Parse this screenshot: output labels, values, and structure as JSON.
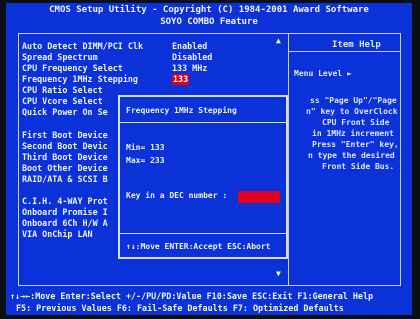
{
  "header": {
    "title": "CMOS Setup Utility - Copyright (C) 1984-2001 Award Software",
    "subtitle": "SOYO COMBO Feature"
  },
  "menu_items": [
    {
      "label": "Auto Detect DIMM/PCI Clk",
      "value": "Enabled"
    },
    {
      "label": "Spread Spectrum",
      "value": "Disabled"
    },
    {
      "label": "CPU Frequency Select",
      "value": "133 MHz"
    },
    {
      "label": "Frequency 1MHz Stepping",
      "value": "133"
    },
    {
      "label": "CPU Ratio Select",
      "value": ""
    },
    {
      "label": "CPU Vcore Select",
      "value": ""
    },
    {
      "label": "Quick Power On Se",
      "value": ""
    },
    {
      "label": "First Boot Device",
      "value": ""
    },
    {
      "label": "Second Boot Devic",
      "value": ""
    },
    {
      "label": "Third Boot Device",
      "value": ""
    },
    {
      "label": "Boot Other Device",
      "value": ""
    },
    {
      "label": "RAID/ATA & SCSI B",
      "value": ""
    },
    {
      "label": "C.I.H. 4-WAY Prot",
      "value": ""
    },
    {
      "label": "Onboard Promise I",
      "value": ""
    },
    {
      "label": "Onboard 6Ch H/W A",
      "value": ""
    },
    {
      "label": "VIA OnChip LAN",
      "value": ""
    }
  ],
  "help_panel": {
    "title": "Item Help",
    "menu_level": "Menu Level  ►",
    "lines": [
      "ss \"Page Up\"/\"Page",
      "n\" key to OverClock",
      "CPU Front Side",
      "in 1MHz increment",
      "Press \"Enter\" key,",
      "n type the desired",
      "Front Side Bus."
    ]
  },
  "dialog": {
    "title": "Frequency 1MHz Stepping",
    "min": "Min= 133",
    "max": "Max= 233",
    "prompt": "Key in a DEC number :",
    "input_value": "",
    "footer": "↑↓:Move ENTER:Accept ESC:Abort"
  },
  "footer": {
    "line1": "↑↓→←:Move  Enter:Select  +/-/PU/PD:Value  F10:Save  ESC:Exit  F1:General Help",
    "line2": "F5: Previous Values    F6: Fail-Safe Defaults    F7: Optimized Defaults"
  },
  "scroll": {
    "up": "▲",
    "down": "▼"
  }
}
